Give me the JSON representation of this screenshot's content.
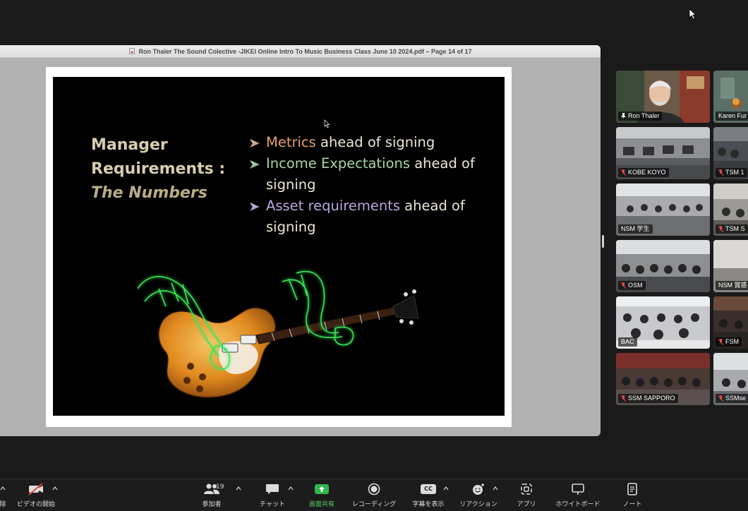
{
  "document": {
    "title": "Ron Thaler The Sound Colective -JIKEI Online Intro To Music Business Class June 10 2024.pdf – Page 14 of 17"
  },
  "slide": {
    "heading": [
      "Manager",
      "Requirements :",
      "The Numbers"
    ],
    "bullets": [
      {
        "highlight": "Metrics",
        "rest": " ahead of signing"
      },
      {
        "highlight": "Income Expectations",
        "rest": " ahead of signing"
      },
      {
        "highlight": "Asset requirements",
        "rest": " ahead of signing"
      }
    ],
    "colors": {
      "heading": "#d8cdb0",
      "metrics": "#e6a06a",
      "income": "#a6d7a6",
      "asset": "#b9a7df"
    }
  },
  "participants": [
    {
      "name": "Ron Thaler",
      "pinned": true,
      "active": true
    },
    {
      "name": "Karen Fur"
    },
    {
      "name": "KOBE KOYO",
      "muted": true
    },
    {
      "name": "TSM 1",
      "muted": true
    },
    {
      "name": "NSM 学生"
    },
    {
      "name": "TSM S",
      "muted": true
    },
    {
      "name": "OSM",
      "muted": true
    },
    {
      "name": "NSM 賞惑"
    },
    {
      "name": "BAC"
    },
    {
      "name": "FSM",
      "muted": true
    },
    {
      "name": "SSM SAPPORO",
      "muted": true
    },
    {
      "name": "SSMse",
      "muted": true
    }
  ],
  "toolbar": {
    "edge_label": "除",
    "video": "ビデオの開始",
    "participants": "参加者",
    "participants_count": "19",
    "chat": "チャット",
    "share": "画面共有",
    "record": "レコーディング",
    "captions": "字幕を表示",
    "reactions": "リアクション",
    "apps": "アプリ",
    "whiteboard": "ホワイトボード",
    "notes": "ノート",
    "cc_badge": "CC"
  },
  "icons": [
    "pointer-icon",
    "pdf-icon",
    "chevron-right-icon",
    "guitar-illustration",
    "pin-icon",
    "mic-muted-icon",
    "video-off-icon",
    "people-icon",
    "chat-icon",
    "share-screen-icon",
    "record-icon",
    "captions-icon",
    "reaction-icon",
    "apps-icon",
    "whiteboard-icon",
    "notes-icon",
    "caret-up-icon"
  ]
}
